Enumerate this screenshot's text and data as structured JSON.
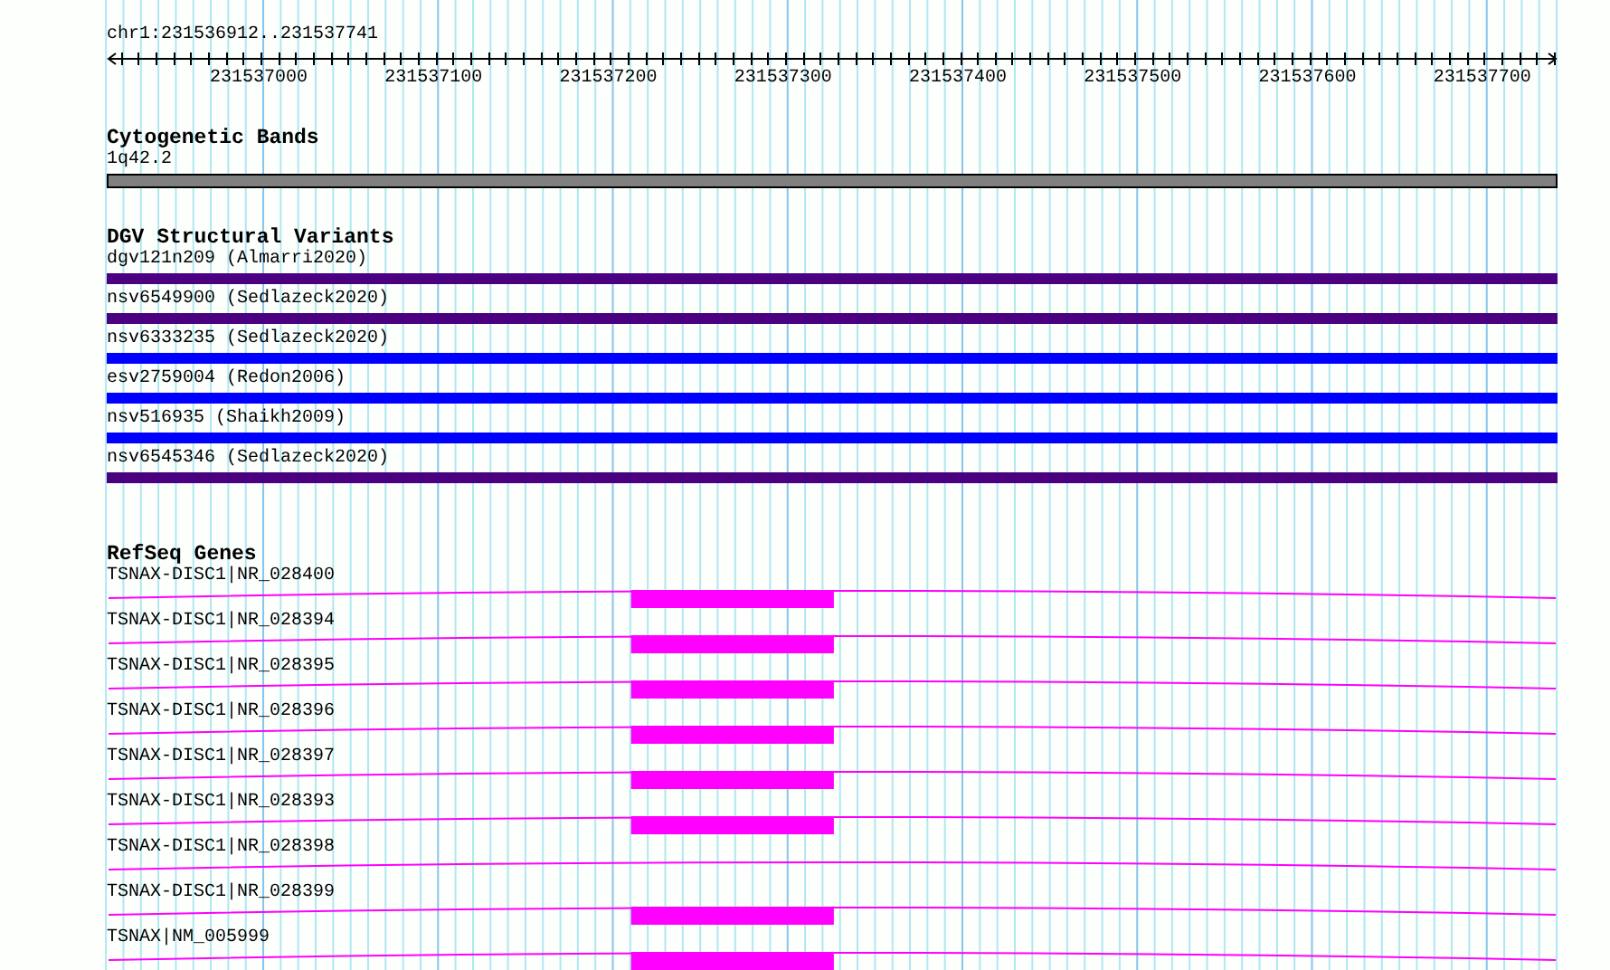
{
  "location": "chr1:231536912..231537741",
  "ruler": {
    "tick_labels": [
      "231537000",
      "231537100",
      "231537200",
      "231537300",
      "231537400",
      "231537500",
      "231537600",
      "231537700"
    ]
  },
  "tracks": [
    {
      "kind": "cytoband",
      "title": "Cytogenetic Bands",
      "features": [
        {
          "label": "1q42.2"
        }
      ]
    },
    {
      "kind": "variants",
      "title": "DGV Structural Variants",
      "features": [
        {
          "label": "dgv121n209 (Almarri2020)",
          "color": "#4b0082"
        },
        {
          "label": "nsv6549900 (Sedlazeck2020)",
          "color": "#4b0082"
        },
        {
          "label": "nsv6333235 (Sedlazeck2020)",
          "color": "#0000ff"
        },
        {
          "label": "esv2759004 (Redon2006)",
          "color": "#0000ff"
        },
        {
          "label": "nsv516935 (Shaikh2009)",
          "color": "#0000ff"
        },
        {
          "label": "nsv6545346 (Sedlazeck2020)",
          "color": "#4b0082"
        }
      ]
    },
    {
      "kind": "genes",
      "title": "RefSeq Genes",
      "features": [
        {
          "label": "TSNAX-DISC1|NR_028400",
          "exon_shown": true
        },
        {
          "label": "TSNAX-DISC1|NR_028394",
          "exon_shown": true
        },
        {
          "label": "TSNAX-DISC1|NR_028395",
          "exon_shown": true
        },
        {
          "label": "TSNAX-DISC1|NR_028396",
          "exon_shown": true
        },
        {
          "label": "TSNAX-DISC1|NR_028397",
          "exon_shown": true
        },
        {
          "label": "TSNAX-DISC1|NR_028393",
          "exon_shown": true
        },
        {
          "label": "TSNAX-DISC1|NR_028398",
          "exon_shown": false
        },
        {
          "label": "TSNAX-DISC1|NR_028399",
          "exon_shown": true
        },
        {
          "label": "TSNAX|NM_005999",
          "exon_shown": true
        }
      ]
    }
  ]
}
